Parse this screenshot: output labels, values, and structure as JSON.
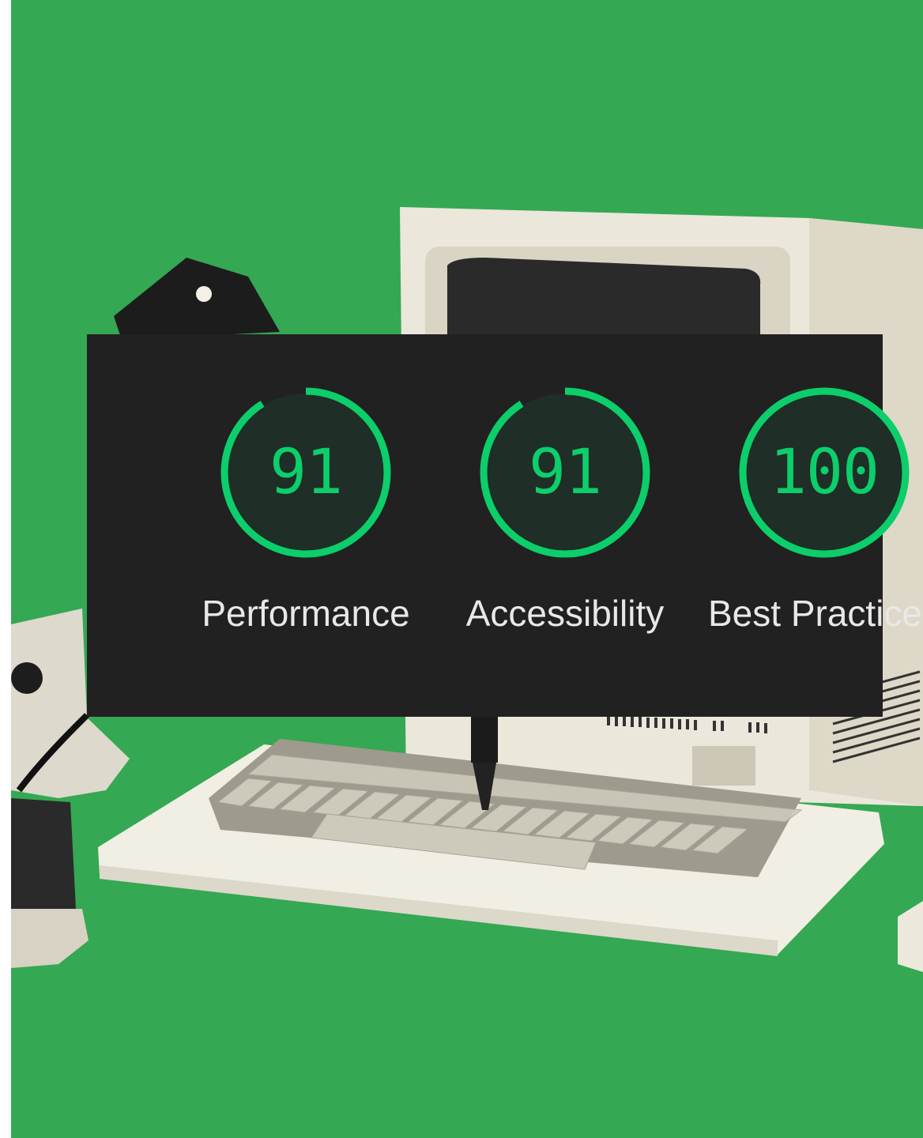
{
  "colors": {
    "background": "#34a853",
    "panel": "#212121",
    "score_pass": "#0cce6b",
    "label_text": "#e8e8e8"
  },
  "scores": [
    {
      "label": "Performance",
      "value": "91",
      "fraction": 0.91
    },
    {
      "label": "Accessibility",
      "value": "91",
      "fraction": 0.91
    },
    {
      "label": "Best Practices",
      "value": "100",
      "fraction": 1.0
    }
  ]
}
